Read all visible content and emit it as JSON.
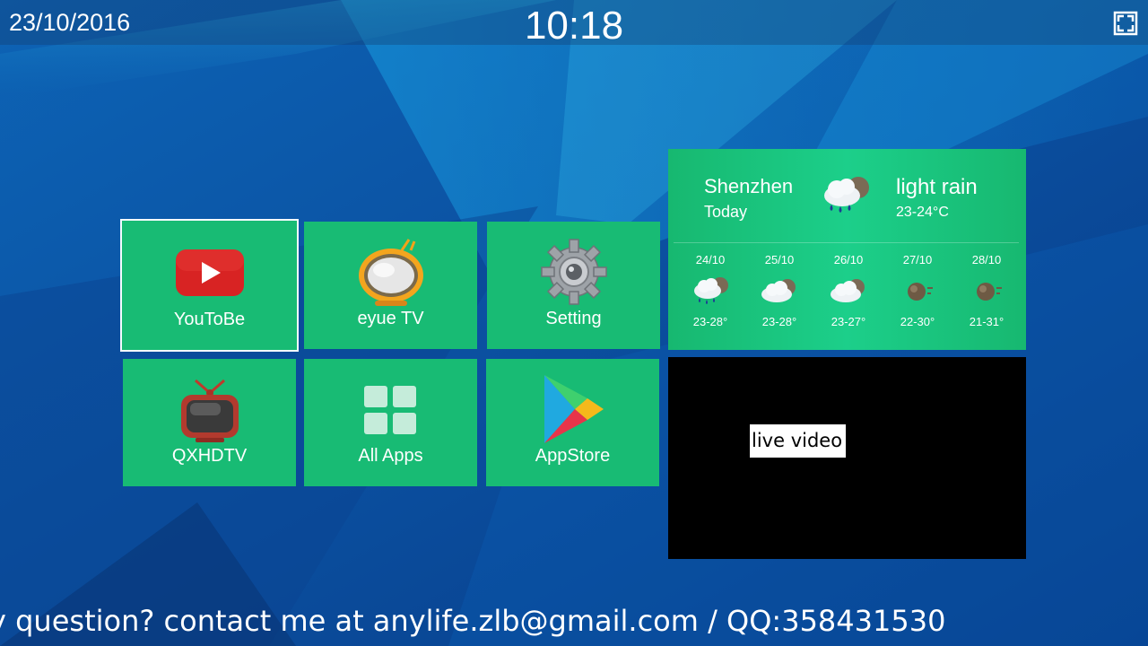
{
  "status_bar": {
    "date": "23/10/2016",
    "time": "10:18",
    "fullscreen_icon": "fullscreen-icon"
  },
  "apps": [
    {
      "label": "YouToBe",
      "icon": "youtube-icon"
    },
    {
      "label": "eyue TV",
      "icon": "retro-tv-icon"
    },
    {
      "label": "Setting",
      "icon": "gear-icon"
    },
    {
      "label": "QXHDTV",
      "icon": "tv-icon"
    },
    {
      "label": "All Apps",
      "icon": "grid-icon"
    },
    {
      "label": "AppStore",
      "icon": "play-store-icon"
    }
  ],
  "weather": {
    "city": "Shenzhen",
    "day": "Today",
    "condition": "light rain",
    "range": "23-24°C",
    "icon": "rain-cloud-icon",
    "forecast": [
      {
        "date": "24/10",
        "temp": "23-28°",
        "icon": "rain-cloud-icon"
      },
      {
        "date": "25/10",
        "temp": "23-28°",
        "icon": "partly-cloudy-icon"
      },
      {
        "date": "26/10",
        "temp": "23-27°",
        "icon": "partly-cloudy-icon"
      },
      {
        "date": "27/10",
        "temp": "22-30°",
        "icon": "haze-icon"
      },
      {
        "date": "28/10",
        "temp": "21-31°",
        "icon": "haze-icon"
      }
    ]
  },
  "video": {
    "label": "live video"
  },
  "ticker": {
    "text": "y question? contact me at anylife.zlb@gmail.com / QQ:358431530"
  },
  "colors": {
    "tile": "#18bb74",
    "background": "#0a4f9e",
    "focus": "#f4fbff"
  }
}
